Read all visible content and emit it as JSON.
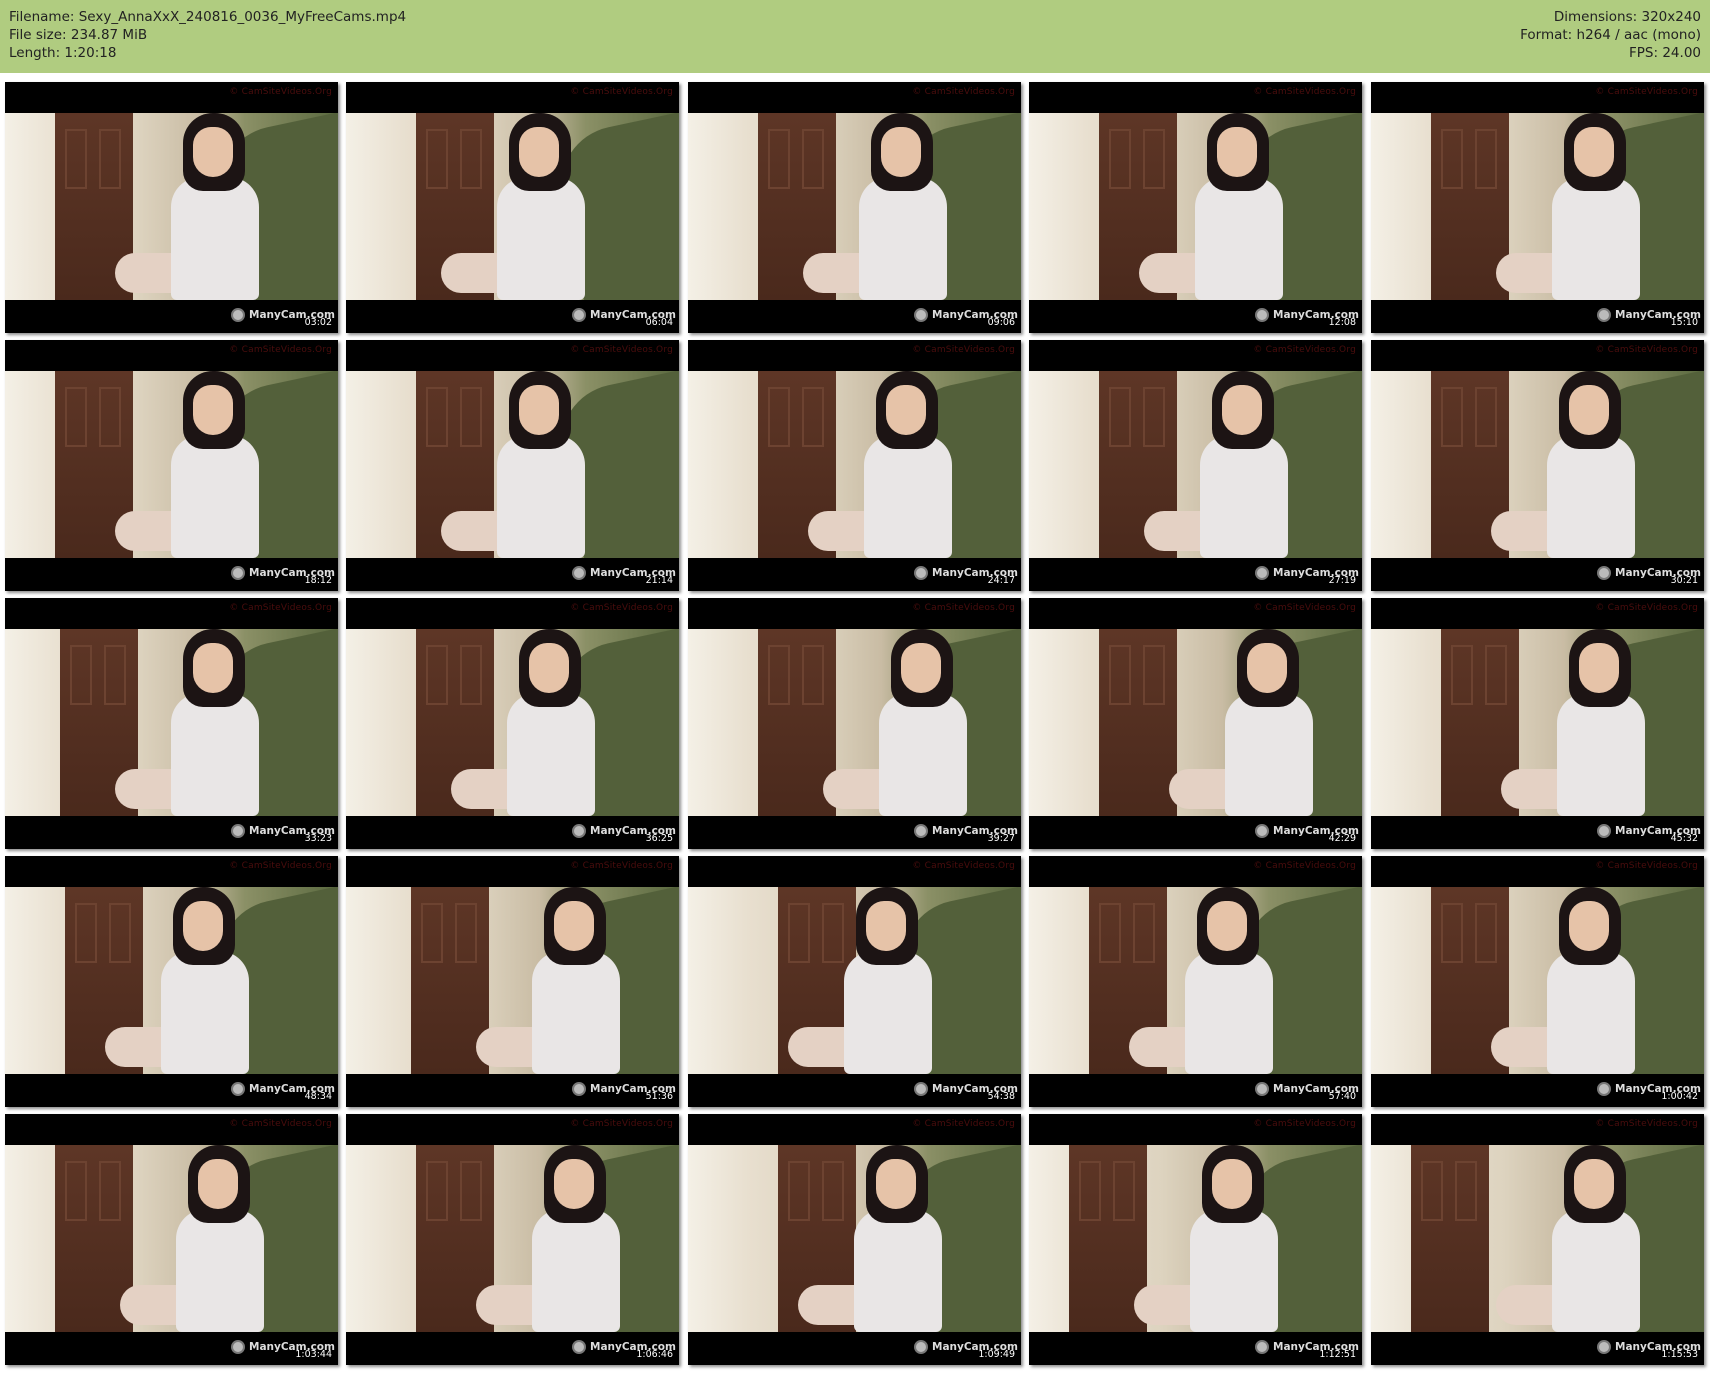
{
  "header": {
    "filename_line": "Filename: Sexy_AnnaXxX_240816_0036_MyFreeCams.mp4",
    "filesize_line": "File size: 234.87 MiB",
    "length_line": "Length: 1:20:18",
    "dimensions_line": "Dimensions: 320x240",
    "format_line": "Format: h264 / aac (mono)",
    "fps_line": "FPS: 24.00"
  },
  "thumbnails": {
    "overlay_text": "© CamSiteVideos.Org",
    "logo_text": "ManyCam.com",
    "timestamps": [
      "03:02",
      "06:04",
      "09:06",
      "12:08",
      "15:10",
      "18:12",
      "21:14",
      "24:17",
      "27:19",
      "30:21",
      "33:23",
      "36:25",
      "39:27",
      "42:29",
      "45:32",
      "48:34",
      "51:36",
      "54:38",
      "57:40",
      "1:00:42",
      "1:03:44",
      "1:06:46",
      "1:09:49",
      "1:12:51",
      "1:15:53"
    ]
  }
}
